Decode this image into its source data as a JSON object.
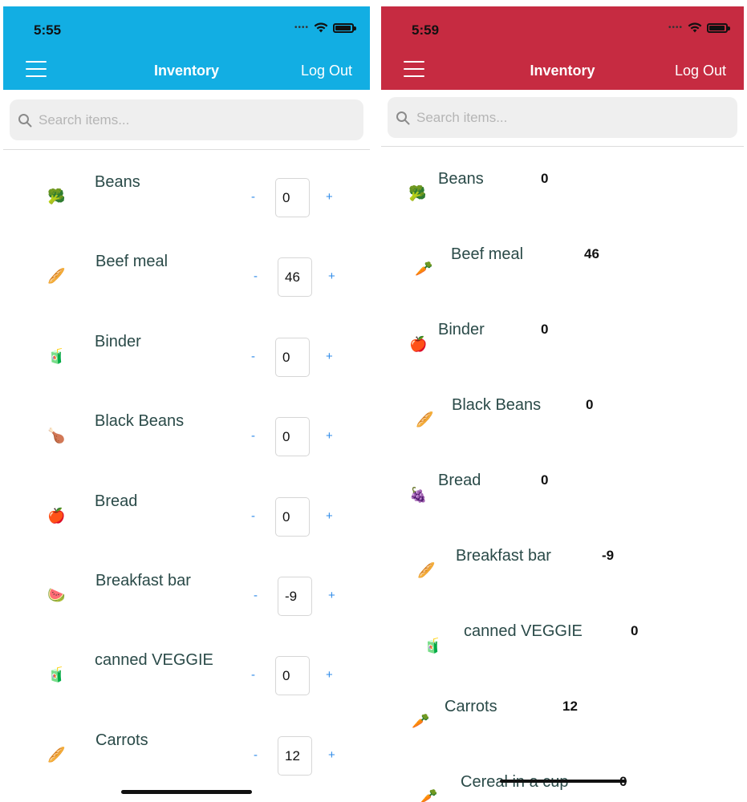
{
  "left": {
    "header_color": "#12aee3",
    "status_time": "5:55",
    "title": "Inventory",
    "logout": "Log Out",
    "search_placeholder": "Search items...",
    "items": [
      {
        "name": "Beans",
        "icon": "🥦",
        "icon_name": "broccoli-icon",
        "qty": "0"
      },
      {
        "name": "Beef meal",
        "icon": "🥖",
        "icon_name": "bread-icon",
        "qty": "46"
      },
      {
        "name": "Binder",
        "icon": "🧃",
        "icon_name": "juice-box-icon",
        "qty": "0"
      },
      {
        "name": "Black Beans",
        "icon": "🍗",
        "icon_name": "poultry-leg-icon",
        "qty": "0"
      },
      {
        "name": "Bread",
        "icon": "🍎",
        "icon_name": "apple-icon",
        "qty": "0"
      },
      {
        "name": "Breakfast bar",
        "icon": "🍉",
        "icon_name": "watermelon-icon",
        "qty": "-9"
      },
      {
        "name": "canned VEGGIE",
        "icon": "🧃",
        "icon_name": "juice-box-icon",
        "qty": "0"
      },
      {
        "name": "Carrots",
        "icon": "🥖",
        "icon_name": "bread-icon",
        "qty": "12"
      }
    ],
    "minus_label": "-",
    "plus_label": "+"
  },
  "right": {
    "header_color": "#c62b41",
    "status_time": "5:59",
    "title": "Inventory",
    "logout": "Log Out",
    "search_placeholder": "Search items...",
    "items": [
      {
        "name": "Beans",
        "icon": "🥦",
        "icon_name": "broccoli-icon",
        "qty": "0"
      },
      {
        "name": "Beef meal",
        "icon": "🥕",
        "icon_name": "carrot-icon",
        "qty": "46"
      },
      {
        "name": "Binder",
        "icon": "🍎",
        "icon_name": "apple-icon",
        "qty": "0"
      },
      {
        "name": "Black Beans",
        "icon": "🥖",
        "icon_name": "bread-icon",
        "qty": "0"
      },
      {
        "name": "Bread",
        "icon": "🍇",
        "icon_name": "grapes-icon",
        "qty": "0"
      },
      {
        "name": "Breakfast bar",
        "icon": "🥖",
        "icon_name": "bread-icon",
        "qty": "-9"
      },
      {
        "name": "canned VEGGIE",
        "icon": "🧃",
        "icon_name": "juice-box-icon",
        "qty": "0"
      },
      {
        "name": "Carrots",
        "icon": "🥕",
        "icon_name": "carrot-icon",
        "qty": "12"
      },
      {
        "name": "Cereal in a cup",
        "icon": "🥕",
        "icon_name": "carrot-icon",
        "qty": "0"
      }
    ]
  }
}
